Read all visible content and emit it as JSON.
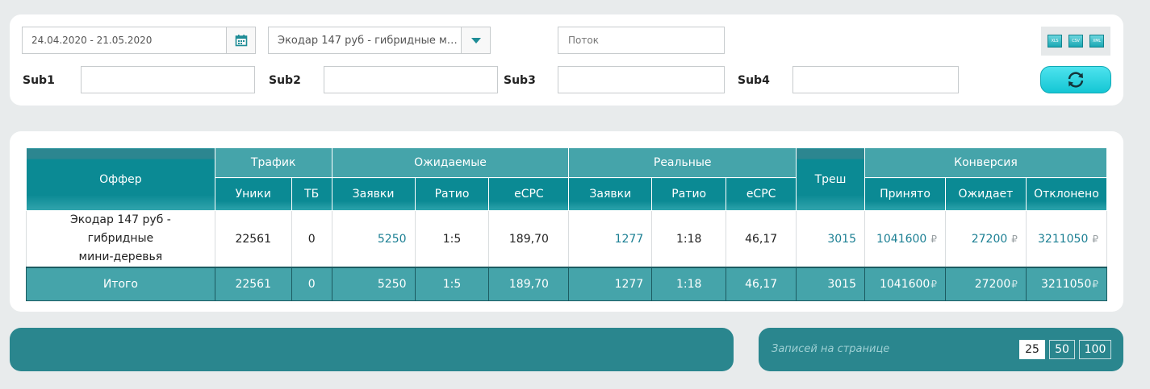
{
  "filters": {
    "date_range": "24.04.2020 - 21.05.2020",
    "offer": "Экодар 147 руб - гибридные мини-деревья",
    "flow_placeholder": "Поток",
    "sub_labels": [
      "Sub1",
      "Sub2",
      "Sub3",
      "Sub4"
    ],
    "export": [
      "XLS",
      "CSV",
      "XML"
    ]
  },
  "table": {
    "groups": {
      "offer": "Оффер",
      "traffic": "Трафик",
      "expected": "Ожидаемые",
      "real": "Реальные",
      "trash": "Треш",
      "conversion": "Конверсия"
    },
    "subheaders": {
      "uniques": "Уники",
      "tb": "ТБ",
      "exp_orders": "Заявки",
      "exp_ratio": "Ратио",
      "exp_ecpc": "eCPC",
      "real_orders": "Заявки",
      "real_ratio": "Ратио",
      "real_ecpc": "eCPC",
      "accepted": "Принято",
      "pending": "Ожидает",
      "rejected": "Отклонено"
    },
    "row": {
      "offer_line1": "Экодар 147 руб - гибридные",
      "offer_line2": "мини-деревья",
      "uniques": "22561",
      "tb": "0",
      "exp_orders": "5250",
      "exp_ratio": "1:5",
      "exp_ecpc": "189,70",
      "real_orders": "1277",
      "real_ratio": "1:18",
      "real_ecpc": "46,17",
      "trash": "3015",
      "accepted": "1041600",
      "pending": "27200",
      "rejected": "3211050"
    },
    "total": {
      "label": "Итого",
      "uniques": "22561",
      "tb": "0",
      "exp_orders": "5250",
      "exp_ratio": "1:5",
      "exp_ecpc": "189,70",
      "real_orders": "1277",
      "real_ratio": "1:18",
      "real_ecpc": "46,17",
      "trash": "3015",
      "accepted": "1041600",
      "pending": "27200",
      "rejected": "3211050"
    },
    "currency": "₽"
  },
  "pagination": {
    "per_page_label": "Записей на странице",
    "options": [
      "25",
      "50",
      "100"
    ],
    "selected": "25"
  },
  "colors": {
    "accent": "#45a4aa",
    "header_dark": "#0b8a94",
    "link": "#1b7f93",
    "refresh": "#14c6d4"
  }
}
